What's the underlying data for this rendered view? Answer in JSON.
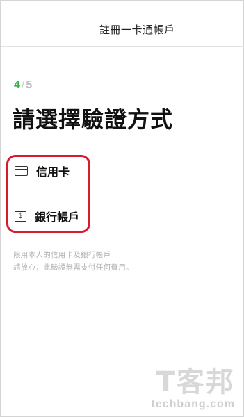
{
  "header": {
    "title": "註冊一卡通帳戶"
  },
  "step": {
    "current": "4",
    "separator": "/",
    "total": "5"
  },
  "page_title": "請選擇驗證方式",
  "options": [
    {
      "label": "信用卡",
      "icon": "credit-card-icon"
    },
    {
      "label": "銀行帳戶",
      "icon": "bank-dollar-icon",
      "icon_glyph": "$"
    }
  ],
  "notes": [
    "限用本人的信用卡及銀行帳戶",
    "請放心，此驗證無需支付任何費用。"
  ],
  "watermark": {
    "logo": "T客邦",
    "text": "techbang.com"
  },
  "colors": {
    "step_accent": "#2fb34a",
    "highlight_border": "#d81a2f",
    "note_text": "#b0b0b0"
  }
}
